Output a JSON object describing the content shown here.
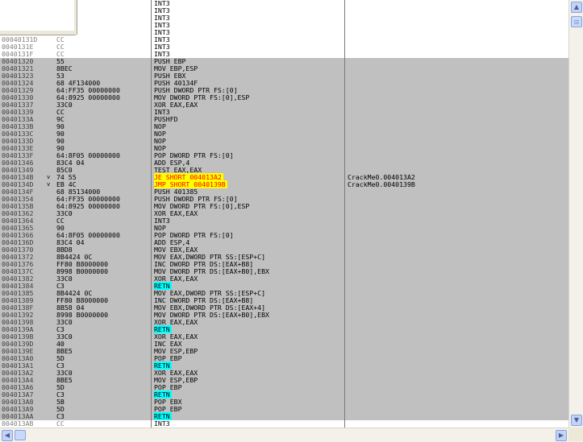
{
  "colors": {
    "selection": "#c0c0c0",
    "jump_highlight": "#ffff00",
    "jump_text": "#ff0000",
    "ret_highlight": "#00ffff"
  },
  "icons": {
    "scroll_up": "scroll-up-arrow-icon",
    "scroll_down": "scroll-down-arrow-icon",
    "scroll_left": "scroll-left-arrow-icon",
    "scroll_right": "scroll-right-arrow-icon"
  },
  "rows": [
    {
      "addr": "",
      "mark": "",
      "hex": "",
      "dis": "INT3",
      "cmt": "",
      "hl": "",
      "style": "normal"
    },
    {
      "addr": "",
      "mark": "",
      "hex": "",
      "dis": "INT3",
      "cmt": "",
      "hl": "",
      "style": "normal"
    },
    {
      "addr": "",
      "mark": "",
      "hex": "",
      "dis": "INT3",
      "cmt": "",
      "hl": "",
      "style": "normal"
    },
    {
      "addr": "",
      "mark": "",
      "hex": "",
      "dis": "INT3",
      "cmt": "",
      "hl": "",
      "style": "normal"
    },
    {
      "addr": "",
      "mark": "",
      "hex": "",
      "dis": "INT3",
      "cmt": "",
      "hl": "",
      "style": "normal"
    },
    {
      "addr": "00040131D",
      "mark": "",
      "hex": "CC",
      "dis": "INT3",
      "cmt": "",
      "hl": "",
      "style": "gray"
    },
    {
      "addr": "0040131E",
      "mark": "",
      "hex": "CC",
      "dis": "INT3",
      "cmt": "",
      "hl": "",
      "style": "gray"
    },
    {
      "addr": "0040131F",
      "mark": "",
      "hex": "CC",
      "dis": "INT3",
      "cmt": "",
      "hl": "",
      "style": "gray"
    },
    {
      "addr": "00401320",
      "mark": "",
      "hex": "55",
      "dis": "PUSH EBP",
      "cmt": "",
      "hl": "",
      "style": "sel"
    },
    {
      "addr": "00401321",
      "mark": "",
      "hex": "8BEC",
      "dis": "MOV EBP,ESP",
      "cmt": "",
      "hl": "",
      "style": "sel"
    },
    {
      "addr": "00401323",
      "mark": "",
      "hex": "53",
      "dis": "PUSH EBX",
      "cmt": "",
      "hl": "",
      "style": "sel"
    },
    {
      "addr": "00401324",
      "mark": "",
      "hex": "68 4F134000",
      "dis": "PUSH 40134F",
      "cmt": "",
      "hl": "",
      "style": "sel"
    },
    {
      "addr": "00401329",
      "mark": "",
      "hex": "64:FF35 00000000",
      "dis": "PUSH DWORD PTR FS:[0]",
      "cmt": "",
      "hl": "",
      "style": "sel"
    },
    {
      "addr": "00401330",
      "mark": "",
      "hex": "64:8925 00000000",
      "dis": "MOV DWORD PTR FS:[0],ESP",
      "cmt": "",
      "hl": "",
      "style": "sel"
    },
    {
      "addr": "00401337",
      "mark": "",
      "hex": "33C0",
      "dis": "XOR EAX,EAX",
      "cmt": "",
      "hl": "",
      "style": "sel"
    },
    {
      "addr": "00401339",
      "mark": "",
      "hex": "CC",
      "dis": "INT3",
      "cmt": "",
      "hl": "",
      "style": "sel"
    },
    {
      "addr": "0040133A",
      "mark": "",
      "hex": "9C",
      "dis": "PUSHFD",
      "cmt": "",
      "hl": "",
      "style": "sel"
    },
    {
      "addr": "0040133B",
      "mark": "",
      "hex": "90",
      "dis": "NOP",
      "cmt": "",
      "hl": "",
      "style": "sel"
    },
    {
      "addr": "0040133C",
      "mark": "",
      "hex": "90",
      "dis": "NOP",
      "cmt": "",
      "hl": "",
      "style": "sel"
    },
    {
      "addr": "0040133D",
      "mark": "",
      "hex": "90",
      "dis": "NOP",
      "cmt": "",
      "hl": "",
      "style": "sel"
    },
    {
      "addr": "0040133E",
      "mark": "",
      "hex": "90",
      "dis": "NOP",
      "cmt": "",
      "hl": "",
      "style": "sel"
    },
    {
      "addr": "0040133F",
      "mark": "",
      "hex": "64:8F05 00000000",
      "dis": "POP DWORD PTR FS:[0]",
      "cmt": "",
      "hl": "",
      "style": "sel"
    },
    {
      "addr": "00401346",
      "mark": "",
      "hex": "83C4 04",
      "dis": "ADD ESP,4",
      "cmt": "",
      "hl": "",
      "style": "sel"
    },
    {
      "addr": "00401349",
      "mark": "",
      "hex": "85C0",
      "dis": "TEST EAX,EAX",
      "cmt": "",
      "hl": "",
      "style": "sel"
    },
    {
      "addr": "0040134B",
      "mark": "v",
      "hex": "74 55",
      "dis": "JE SHORT 004013A2",
      "cmt": "CrackMe0.004013A2",
      "hl": "yellow",
      "style": "sel"
    },
    {
      "addr": "0040134D",
      "mark": "v",
      "hex": "EB 4C",
      "dis": "JMP SHORT 0040139B",
      "cmt": "CrackMe0.0040139B",
      "hl": "yellow",
      "style": "sel"
    },
    {
      "addr": "0040134F",
      "mark": "",
      "hex": "68 85134000",
      "dis": "PUSH 401385",
      "cmt": "",
      "hl": "",
      "style": "sel"
    },
    {
      "addr": "00401354",
      "mark": "",
      "hex": "64:FF35 00000000",
      "dis": "PUSH DWORD PTR FS:[0]",
      "cmt": "",
      "hl": "",
      "style": "sel"
    },
    {
      "addr": "0040135B",
      "mark": "",
      "hex": "64:8925 00000000",
      "dis": "MOV DWORD PTR FS:[0],ESP",
      "cmt": "",
      "hl": "",
      "style": "sel"
    },
    {
      "addr": "00401362",
      "mark": "",
      "hex": "33C0",
      "dis": "XOR EAX,EAX",
      "cmt": "",
      "hl": "",
      "style": "sel"
    },
    {
      "addr": "00401364",
      "mark": "",
      "hex": "CC",
      "dis": "INT3",
      "cmt": "",
      "hl": "",
      "style": "sel"
    },
    {
      "addr": "00401365",
      "mark": "",
      "hex": "90",
      "dis": "NOP",
      "cmt": "",
      "hl": "",
      "style": "sel"
    },
    {
      "addr": "00401366",
      "mark": "",
      "hex": "64:8F05 00000000",
      "dis": "POP DWORD PTR FS:[0]",
      "cmt": "",
      "hl": "",
      "style": "sel"
    },
    {
      "addr": "0040136D",
      "mark": "",
      "hex": "83C4 04",
      "dis": "ADD ESP,4",
      "cmt": "",
      "hl": "",
      "style": "sel"
    },
    {
      "addr": "00401370",
      "mark": "",
      "hex": "8BD8",
      "dis": "MOV EBX,EAX",
      "cmt": "",
      "hl": "",
      "style": "sel"
    },
    {
      "addr": "00401372",
      "mark": "",
      "hex": "8B4424 0C",
      "dis": "MOV EAX,DWORD PTR SS:[ESP+C]",
      "cmt": "",
      "hl": "",
      "style": "sel"
    },
    {
      "addr": "00401376",
      "mark": "",
      "hex": "FF80 B8000000",
      "dis": "INC DWORD PTR DS:[EAX+B8]",
      "cmt": "",
      "hl": "",
      "style": "sel"
    },
    {
      "addr": "0040137C",
      "mark": "",
      "hex": "8998 B0000000",
      "dis": "MOV DWORD PTR DS:[EAX+B0],EBX",
      "cmt": "",
      "hl": "",
      "style": "sel"
    },
    {
      "addr": "00401382",
      "mark": "",
      "hex": "33C0",
      "dis": "XOR EAX,EAX",
      "cmt": "",
      "hl": "",
      "style": "sel"
    },
    {
      "addr": "00401384",
      "mark": "",
      "hex": "C3",
      "dis": "RETN",
      "cmt": "",
      "hl": "cyan",
      "style": "sel"
    },
    {
      "addr": "00401385",
      "mark": "",
      "hex": "8B4424 0C",
      "dis": "MOV EAX,DWORD PTR SS:[ESP+C]",
      "cmt": "",
      "hl": "",
      "style": "sel"
    },
    {
      "addr": "00401389",
      "mark": "",
      "hex": "FF80 B8000000",
      "dis": "INC DWORD PTR DS:[EAX+B8]",
      "cmt": "",
      "hl": "",
      "style": "sel"
    },
    {
      "addr": "0040138F",
      "mark": "",
      "hex": "8B58 04",
      "dis": "MOV EBX,DWORD PTR DS:[EAX+4]",
      "cmt": "",
      "hl": "",
      "style": "sel"
    },
    {
      "addr": "00401392",
      "mark": "",
      "hex": "8998 B0000000",
      "dis": "MOV DWORD PTR DS:[EAX+B0],EBX",
      "cmt": "",
      "hl": "",
      "style": "sel"
    },
    {
      "addr": "00401398",
      "mark": "",
      "hex": "33C0",
      "dis": "XOR EAX,EAX",
      "cmt": "",
      "hl": "",
      "style": "sel"
    },
    {
      "addr": "0040139A",
      "mark": "",
      "hex": "C3",
      "dis": "RETN",
      "cmt": "",
      "hl": "cyan",
      "style": "sel"
    },
    {
      "addr": "0040139B",
      "mark": "",
      "hex": "33C0",
      "dis": "XOR EAX,EAX",
      "cmt": "",
      "hl": "",
      "style": "sel"
    },
    {
      "addr": "0040139D",
      "mark": "",
      "hex": "40",
      "dis": "INC EAX",
      "cmt": "",
      "hl": "",
      "style": "sel"
    },
    {
      "addr": "0040139E",
      "mark": "",
      "hex": "8BE5",
      "dis": "MOV ESP,EBP",
      "cmt": "",
      "hl": "",
      "style": "sel"
    },
    {
      "addr": "004013A0",
      "mark": "",
      "hex": "5D",
      "dis": "POP EBP",
      "cmt": "",
      "hl": "",
      "style": "sel"
    },
    {
      "addr": "004013A1",
      "mark": "",
      "hex": "C3",
      "dis": "RETN",
      "cmt": "",
      "hl": "cyan",
      "style": "sel"
    },
    {
      "addr": "004013A2",
      "mark": "",
      "hex": "33C0",
      "dis": "XOR EAX,EAX",
      "cmt": "",
      "hl": "",
      "style": "sel"
    },
    {
      "addr": "004013A4",
      "mark": "",
      "hex": "8BE5",
      "dis": "MOV ESP,EBP",
      "cmt": "",
      "hl": "",
      "style": "sel"
    },
    {
      "addr": "004013A6",
      "mark": "",
      "hex": "5D",
      "dis": "POP EBP",
      "cmt": "",
      "hl": "",
      "style": "sel"
    },
    {
      "addr": "004013A7",
      "mark": "",
      "hex": "C3",
      "dis": "RETN",
      "cmt": "",
      "hl": "cyan",
      "style": "sel"
    },
    {
      "addr": "004013A8",
      "mark": "",
      "hex": "5B",
      "dis": "POP EBX",
      "cmt": "",
      "hl": "",
      "style": "sel"
    },
    {
      "addr": "004013A9",
      "mark": "",
      "hex": "5D",
      "dis": "POP EBP",
      "cmt": "",
      "hl": "",
      "style": "sel"
    },
    {
      "addr": "004013AA",
      "mark": "",
      "hex": "C3",
      "dis": "RETN",
      "cmt": "",
      "hl": "cyan",
      "style": "sel"
    },
    {
      "addr": "004013AB",
      "mark": "",
      "hex": "CC",
      "dis": "INT3",
      "cmt": "",
      "hl": "",
      "style": "gray"
    }
  ]
}
